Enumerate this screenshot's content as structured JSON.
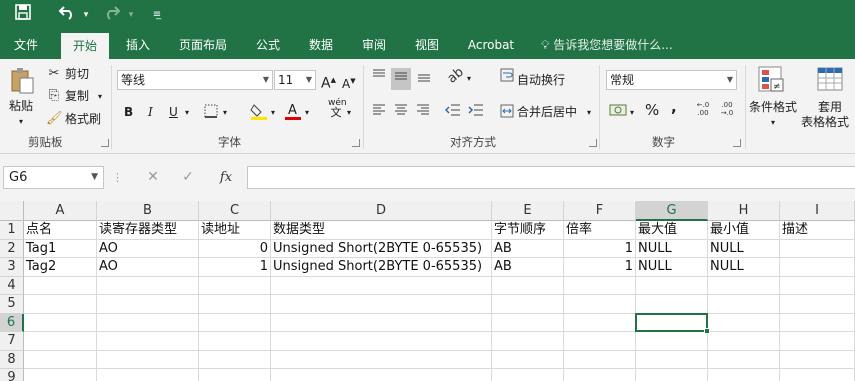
{
  "titlebar": {
    "save_icon": "save-icon",
    "undo_icon": "undo-icon",
    "redo_icon": "redo-icon",
    "customize_icon": "customize-qat-icon"
  },
  "tabs": [
    "文件",
    "开始",
    "插入",
    "页面布局",
    "公式",
    "数据",
    "审阅",
    "视图",
    "Acrobat"
  ],
  "tell_me": "告诉我您想要做什么...",
  "ribbon": {
    "clipboard": {
      "paste": "粘贴",
      "cut": "剪切",
      "copy": "复制",
      "format_painter": "格式刷",
      "label": "剪贴板"
    },
    "font": {
      "name": "等线",
      "size": "11",
      "grow": "A",
      "shrink": "A",
      "bold": "B",
      "italic": "I",
      "underline": "U",
      "wen": "wén",
      "wen_sub": "文",
      "label": "字体"
    },
    "alignment": {
      "wrap": "自动换行",
      "merge": "合并后居中",
      "label": "对齐方式"
    },
    "number": {
      "format": "常规",
      "percent": "%",
      "comma": ",",
      "inc": ".0\n.00",
      "label": "数字"
    },
    "styles": {
      "conditional": "条件格式",
      "table": "套用",
      "table2": "表格格式"
    }
  },
  "formula_bar": {
    "name_box": "G6",
    "fx": "fx",
    "value": ""
  },
  "columns": [
    "A",
    "B",
    "C",
    "D",
    "E",
    "F",
    "G",
    "H",
    "I"
  ],
  "selected_column": "G",
  "rows": [
    "1",
    "2",
    "3",
    "4",
    "5",
    "6",
    "7",
    "8",
    "9"
  ],
  "selected_row": "6",
  "selected_cell": "G6",
  "headers": [
    "点名",
    "读寄存器类型",
    "读地址",
    "数据类型",
    "字节顺序",
    "倍率",
    "最大值",
    "最小值",
    "描述"
  ],
  "data_rows": [
    [
      "Tag1",
      "AO",
      "0",
      "Unsigned Short(2BYTE 0-65535)",
      "AB",
      "1",
      "NULL",
      "NULL",
      ""
    ],
    [
      "Tag2",
      "AO",
      "1",
      "Unsigned Short(2BYTE 0-65535)",
      "AB",
      "1",
      "NULL",
      "NULL",
      ""
    ]
  ],
  "colors": {
    "accent": "#217346",
    "ribbon": "#f3f3f3"
  }
}
